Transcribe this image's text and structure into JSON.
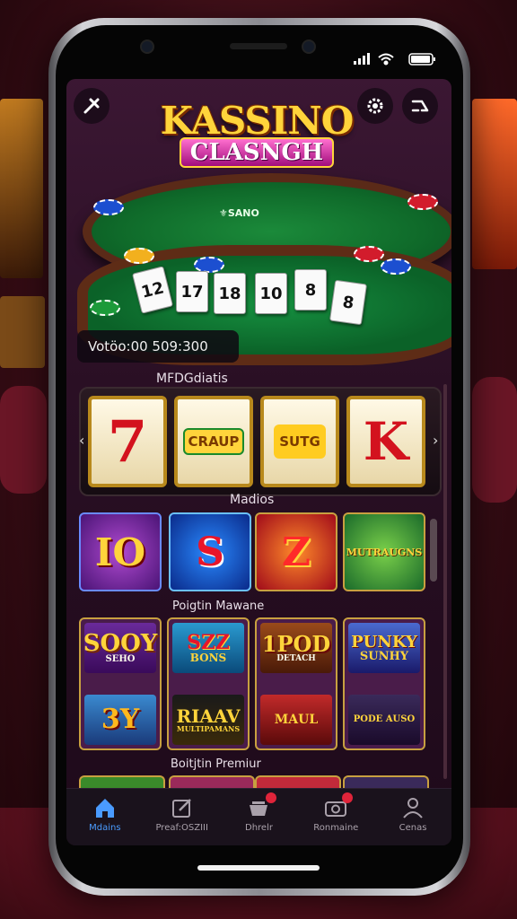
{
  "logo": {
    "line1": "KASSINO",
    "line2": "CLASNGH"
  },
  "table": {
    "felt_text": "⚜SANO"
  },
  "cards": [
    "12",
    "17",
    "18",
    "10",
    "8",
    "8"
  ],
  "balance": {
    "text": "Votöo:00 509:300"
  },
  "sections": {
    "featured": "MFDGdiatis",
    "more": "Madios",
    "popular": "Poigtin Mawane",
    "premium": "Boitjtin Premiur"
  },
  "reels": [
    "7",
    "CRAUP",
    "SUTG",
    "K"
  ],
  "tiles_row1": [
    "IO",
    "S",
    "Z",
    "MUTRAUGNS"
  ],
  "games_grid": [
    {
      "top": "SOOY",
      "top_sub": "SEHO",
      "bottom": "3Y"
    },
    {
      "top": "SZZ",
      "top_sub": "BONS",
      "bottom": "RIAAV",
      "bottom_sub": "MULTIPAMANS"
    },
    {
      "top": "1POD",
      "top_sub": "DETACH",
      "bottom": "MAUL"
    },
    {
      "top": "PUNKY",
      "top_sub": "SUNHY",
      "bottom": "PODE AUSO"
    }
  ],
  "tabs": [
    {
      "label": "Mdains",
      "icon": "home-icon",
      "active": true
    },
    {
      "label": "Preaf:OSZIII",
      "icon": "edit-icon",
      "active": false
    },
    {
      "label": "Dhrelr",
      "icon": "basket-icon",
      "active": false
    },
    {
      "label": "Ronmaine",
      "icon": "camera-icon",
      "active": false
    },
    {
      "label": "Cenas",
      "icon": "user-icon",
      "active": false
    }
  ],
  "colors": {
    "accent": "#4a9bff",
    "gold": "#ffd43b",
    "felt": "#137a33",
    "badge": "#e0243a"
  }
}
